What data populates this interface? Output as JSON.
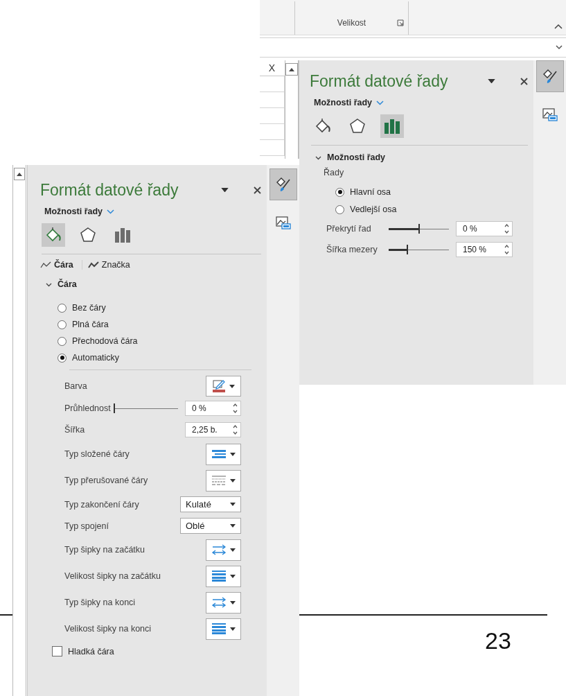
{
  "back_window": {
    "ribbon": {
      "group_label": "Velikost"
    },
    "sheet": {
      "column_header": "X"
    },
    "pane": {
      "title": "Formát datové řady",
      "options_menu": "Možnosti řady",
      "icon_tabs": [
        {
          "kind": "fill",
          "selected": false
        },
        {
          "kind": "effects",
          "selected": false
        },
        {
          "kind": "series",
          "selected": true
        }
      ],
      "section": {
        "title": "Možnosti řady",
        "expanded": true
      },
      "group_label": "Řady",
      "radios": [
        {
          "label": "Hlavní osa",
          "selected": true
        },
        {
          "label": "Vedlejší osa",
          "selected": false
        }
      ],
      "rows": [
        {
          "kind": "slider",
          "label": "Překrytí řad",
          "level": 0.5,
          "value": "0 %"
        },
        {
          "kind": "slider",
          "label": "Šířka mezery",
          "level": 0.3,
          "value": "150 %"
        }
      ]
    },
    "side_tabs": [
      {
        "kind": "format",
        "selected": true
      },
      {
        "kind": "size",
        "selected": false
      }
    ]
  },
  "front_window": {
    "pane": {
      "title": "Formát datové řady",
      "options_menu": "Možnosti řady",
      "icon_tabs": [
        {
          "kind": "fill",
          "selected": true
        },
        {
          "kind": "effects",
          "selected": false
        },
        {
          "kind": "series",
          "selected": false
        }
      ],
      "sub_tabs": [
        {
          "label": "Čára",
          "kind": "line",
          "selected": true
        },
        {
          "label": "Značka",
          "kind": "marker",
          "selected": false
        }
      ],
      "section": {
        "title": "Čára",
        "expanded": true
      },
      "radios": [
        {
          "label": "Bez čáry",
          "selected": false
        },
        {
          "label": "Plná čára",
          "selected": false
        },
        {
          "label": "Přechodová čára",
          "selected": false
        },
        {
          "label": "Automaticky",
          "selected": true
        }
      ],
      "rows": [
        {
          "kind": "color",
          "label": "Barva"
        },
        {
          "kind": "slider",
          "label": "Průhlednost",
          "level": 0,
          "value": "0 %"
        },
        {
          "kind": "spin",
          "label": "Šířka",
          "value": "2,25 b."
        },
        {
          "kind": "icon_select",
          "label": "Typ složené čáry"
        },
        {
          "kind": "icon_select",
          "label": "Typ přerušované čáry"
        },
        {
          "kind": "select",
          "label": "Typ zakončení čáry",
          "value": "Kulaté"
        },
        {
          "kind": "select",
          "label": "Typ spojení",
          "value": "Oblé"
        },
        {
          "kind": "icon_select",
          "label": "Typ šipky na začátku"
        },
        {
          "kind": "icon_select",
          "label": "Velikost šipky na začátku"
        },
        {
          "kind": "icon_select",
          "label": "Typ šipky na konci"
        },
        {
          "kind": "icon_select",
          "label": "Velikost šipky na konci"
        }
      ],
      "checkbox": {
        "label": "Hladká čára",
        "checked": false
      }
    },
    "side_tabs": [
      {
        "kind": "format",
        "selected": true
      },
      {
        "kind": "size",
        "selected": false
      }
    ]
  },
  "page": {
    "page_number": "23"
  }
}
